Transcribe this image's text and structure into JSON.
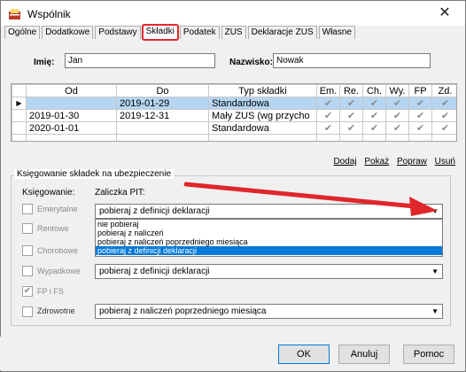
{
  "window": {
    "title": "Wspólnik",
    "close_glyph": "✕",
    "icon": "partner-icon"
  },
  "tabs": [
    "Ogólne",
    "Dodatkowe",
    "Podstawy",
    "Składki",
    "Podatek",
    "ZUS",
    "Deklaracje ZUS",
    "Własne"
  ],
  "active_tab": "Składki",
  "header": {
    "first_name_label": "Imię:",
    "first_name_value": "Jan",
    "last_name_label": "Nazwisko:",
    "last_name_value": "Nowak"
  },
  "grid": {
    "columns": [
      "Od",
      "Do",
      "Typ składki",
      "Em.",
      "Re.",
      "Ch.",
      "Wy.",
      "FP",
      "Zd."
    ],
    "rows": [
      {
        "od": "",
        "do": "2019-01-29",
        "typ": "Standardowa",
        "checks": [
          "✔",
          "✔",
          "✔",
          "✔",
          "✔",
          "✔"
        ]
      },
      {
        "od": "2019-01-30",
        "do": "2019-12-31",
        "typ": "Mały ZUS (wg przycho",
        "checks": [
          "✔",
          "✔",
          "✔",
          "✔",
          "✔",
          "✔"
        ]
      },
      {
        "od": "2020-01-01",
        "do": "",
        "typ": "Standardowa",
        "checks": [
          "✔",
          "✔",
          "✔",
          "✔",
          "✔",
          "✔"
        ]
      }
    ],
    "row_indicator": "▶"
  },
  "grid_links": {
    "add": "Dodaj",
    "show": "Pokaż",
    "edit": "Popraw",
    "delete": "Usuń"
  },
  "insurance": {
    "group_title": "Księgowanie składek na ubezpieczenie",
    "col_posting": "Księgowanie:",
    "col_pit": "Zaliczka PIT:",
    "items": {
      "emerytalne": "Emerytalne",
      "rentowe": "Rentowe",
      "chorobowe": "Chorobowe",
      "wypadkowe": "Wypadkowe",
      "fpifs": "FP i FS",
      "zdrowotne": "Zdrowotne"
    },
    "emerytalne_combo": "pobieraj z definicji deklaracji",
    "wypadkowe_combo": "pobieraj z definicji deklaracji",
    "zdrowotne_combo": "pobieraj z naliczeń poprzedniego miesiąca",
    "dropdown_options": [
      "nie pobieraj",
      "pobieraj z naliczeń",
      "pobieraj z naliczeń poprzedniego miesiąca",
      "pobieraj z definicji deklaracji"
    ],
    "dropdown_selected_index": 3,
    "check_glyph": "✔",
    "combo_arrow": "▼"
  },
  "footer": {
    "ok": "OK",
    "cancel": "Anuluj",
    "help": "Pomoc"
  },
  "colors": {
    "annotation_arrow": "#e0272b",
    "selection": "#0078d7",
    "row_highlight": "#b5d5f1"
  }
}
